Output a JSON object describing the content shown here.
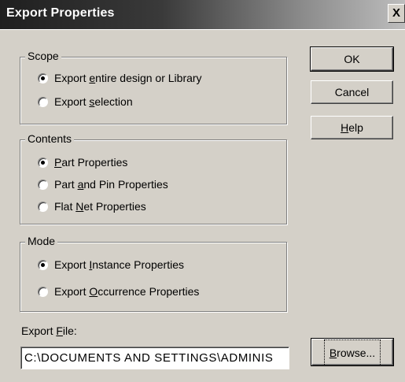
{
  "window": {
    "title": "Export Properties",
    "close_label": "X"
  },
  "scope": {
    "label": "Scope",
    "options": [
      {
        "pre": "Export ",
        "key": "e",
        "post": "ntire design or Library",
        "selected": true
      },
      {
        "pre": "Export ",
        "key": "s",
        "post": "election",
        "selected": false
      }
    ]
  },
  "contents": {
    "label": "Contents",
    "options": [
      {
        "pre": "",
        "key": "P",
        "post": "art Properties",
        "selected": true
      },
      {
        "pre": "Part ",
        "key": "a",
        "post": "nd Pin Properties",
        "selected": false
      },
      {
        "pre": "Flat ",
        "key": "N",
        "post": "et Properties",
        "selected": false
      }
    ]
  },
  "mode": {
    "label": "Mode",
    "options": [
      {
        "pre": "Export ",
        "key": "I",
        "post": "nstance Properties",
        "selected": true
      },
      {
        "pre": "Export ",
        "key": "O",
        "post": "ccurrence Properties",
        "selected": false
      }
    ]
  },
  "buttons": {
    "ok": "OK",
    "cancel": "Cancel",
    "help_key": "H",
    "help_rest": "elp",
    "browse_key": "B",
    "browse_rest": "rowse..."
  },
  "export_file": {
    "label_pre": "Export ",
    "label_key": "F",
    "label_post": "ile:",
    "value": "C:\\DOCUMENTS AND SETTINGS\\ADMINIS"
  }
}
